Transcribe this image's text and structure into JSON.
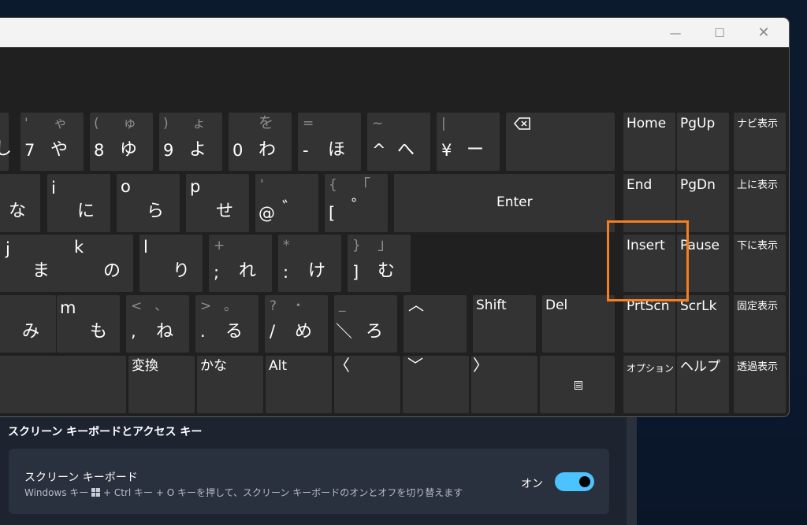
{
  "window": {
    "minimize_icon": "minimize-icon",
    "maximize_icon": "maximize-icon",
    "close_icon": "close-icon"
  },
  "keys": {
    "r1": [
      {
        "k": "shi",
        "sym": "",
        "lat": "",
        "jp": "し"
      },
      {
        "k": "7",
        "sym": "'",
        "sym2": "ゃ",
        "lat": "7",
        "jp": "や"
      },
      {
        "k": "8",
        "sym": "(",
        "sym2": "ゅ",
        "lat": "8",
        "jp": "ゆ"
      },
      {
        "k": "9",
        "sym": ")",
        "sym2": "ょ",
        "lat": "9",
        "jp": "よ"
      },
      {
        "k": "0",
        "sym": "を",
        "lat": "0",
        "jp": "わ"
      },
      {
        "k": "minus",
        "sym": "=",
        "lat": "-",
        "jp": "ほ"
      },
      {
        "k": "caret",
        "sym": "~",
        "lat": "^",
        "jp": "へ"
      },
      {
        "k": "yen",
        "sym": "|",
        "lat": "¥",
        "jp": "ー"
      }
    ],
    "r2": [
      {
        "k": "na",
        "lat": "",
        "jp": "な"
      },
      {
        "k": "i",
        "lat": "i",
        "jp": "に"
      },
      {
        "k": "o",
        "lat": "o",
        "jp": "ら"
      },
      {
        "k": "p",
        "lat": "p",
        "jp": "せ"
      },
      {
        "k": "at",
        "sym": "'",
        "lat": "@",
        "jp": "゛"
      },
      {
        "k": "bracket",
        "sym": "{",
        "sym2": "「",
        "lat": "[",
        "jp": "゜"
      }
    ],
    "r3": [
      {
        "k": "j",
        "lat": "j",
        "jp": "ま"
      },
      {
        "k": "k",
        "lat": "k",
        "jp": "の"
      },
      {
        "k": "l",
        "lat": "l",
        "jp": "り"
      },
      {
        "k": "semicolon",
        "sym": "+",
        "lat": ";",
        "jp": "れ"
      },
      {
        "k": "colon",
        "sym": "*",
        "lat": ":",
        "jp": "け"
      },
      {
        "k": "rbracket",
        "sym": "}",
        "sym2": "」",
        "lat": "]",
        "jp": "む"
      }
    ],
    "r4": [
      {
        "k": "mi",
        "lat": "",
        "jp": "み"
      },
      {
        "k": "m",
        "lat": "m",
        "jp": "も"
      },
      {
        "k": "comma",
        "sym": "<",
        "sym2": "、",
        "lat": ",",
        "jp": "ね"
      },
      {
        "k": "period",
        "sym": ">",
        "sym2": "。",
        "lat": ".",
        "jp": "る"
      },
      {
        "k": "slash",
        "sym": "?",
        "sym2": "・",
        "lat": "/",
        "jp": "め"
      },
      {
        "k": "backslash",
        "sym": "_",
        "lat": "＼",
        "jp": "ろ"
      }
    ],
    "backspace_icon": "backspace-icon",
    "enter": "Enter",
    "shift": "Shift",
    "del": "Del",
    "henkan": "変換",
    "kana": "かな",
    "alt": "Alt",
    "up_arrow": "︿",
    "down_arrow": "﹀",
    "left_arrow": "〈",
    "right_arrow": "〉",
    "menu_icon": "context-menu-icon",
    "home": "Home",
    "pgup": "PgUp",
    "navi_display": "ナビ表示",
    "end": "End",
    "pgdn": "PgDn",
    "move_up": "上に表示",
    "insert": "Insert",
    "pause": "Pause",
    "move_down": "下に表示",
    "prtscn": "PrtScn",
    "scrlk": "ScrLk",
    "dock": "固定表示",
    "options": "オプション",
    "help": "ヘルプ",
    "fade": "透過表示"
  },
  "settings": {
    "section_title": "スクリーン キーボードとアクセス キー",
    "card_title": "スクリーン キーボード",
    "card_desc_1": "Windows キー ",
    "card_desc_2": " + Ctrl キー + O キーを押して、スクリーン キーボードのオンとオフを切り替えます",
    "toggle_label": "オン",
    "toggle_on": true,
    "toggle_color": "#4cc2ff"
  },
  "highlight_color": "#f57f20"
}
